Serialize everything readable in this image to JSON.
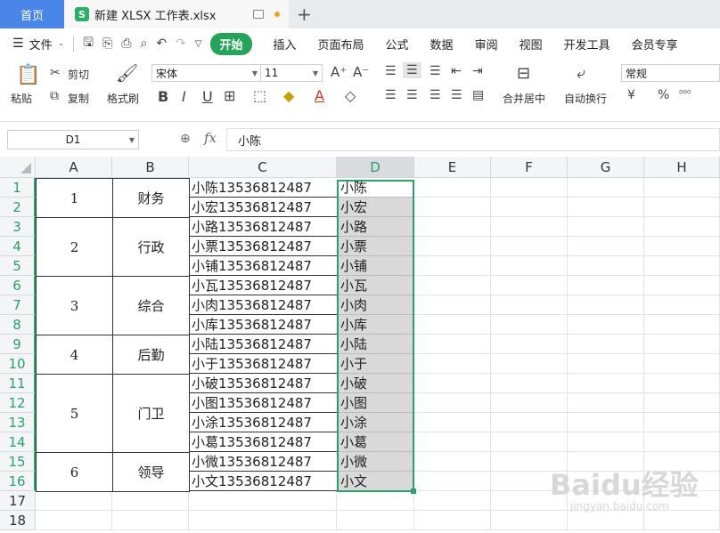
{
  "titlebar": {
    "home_tab": "首页",
    "file_tab": "新建 XLSX 工作表.xlsx",
    "file_logo": "S",
    "new_tab_glyph": "+"
  },
  "menubar": {
    "file_label": "文件",
    "start_label": "开始",
    "items": [
      "插入",
      "页面布局",
      "公式",
      "数据",
      "审阅",
      "视图",
      "开发工具",
      "会员专享"
    ]
  },
  "ribbon": {
    "paste": "粘贴",
    "cut": "剪切",
    "copy": "复制",
    "format_painter": "格式刷",
    "font_name": "宋体",
    "font_size": "11",
    "merge_center": "合并居中",
    "wrap_text": "自动换行",
    "number_format": "常规",
    "currency_symbol": "¥",
    "percent_symbol": "%"
  },
  "formula_bar": {
    "name_box": "D1",
    "fx": "fx",
    "value": "小陈"
  },
  "columns": [
    "A",
    "B",
    "C",
    "D",
    "E",
    "F",
    "G",
    "H"
  ],
  "selected_column": "D",
  "rows": [
    "1",
    "2",
    "3",
    "4",
    "5",
    "6",
    "7",
    "8",
    "9",
    "10",
    "11",
    "12",
    "13",
    "14",
    "15",
    "16",
    "17",
    "18"
  ],
  "merged_groups": [
    {
      "a": "1",
      "b": "财务",
      "rows": [
        1,
        2
      ]
    },
    {
      "a": "2",
      "b": "行政",
      "rows": [
        3,
        5
      ]
    },
    {
      "a": "3",
      "b": "综合",
      "rows": [
        6,
        8
      ]
    },
    {
      "a": "4",
      "b": "后勤",
      "rows": [
        9,
        10
      ]
    },
    {
      "a": "5",
      "b": "门卫",
      "rows": [
        11,
        14
      ]
    },
    {
      "a": "6",
      "b": "领导",
      "rows": [
        15,
        16
      ]
    }
  ],
  "column_c": [
    "小陈13536812487",
    "小宏13536812487",
    "小路13536812487",
    "小票13536812487",
    "小铺13536812487",
    "小瓦13536812487",
    "小肉13536812487",
    "小库13536812487",
    "小陆13536812487",
    "小于13536812487",
    "小破13536812487",
    "小图13536812487",
    "小涂13536812487",
    "小葛13536812487",
    "小微13536812487",
    "小文13536812487"
  ],
  "column_d": [
    "小陈",
    "小宏",
    "小路",
    "小票",
    "小铺",
    "小瓦",
    "小肉",
    "小库",
    "小陆",
    "小于",
    "小破",
    "小图",
    "小涂",
    "小葛",
    "小微",
    "小文"
  ],
  "watermark": {
    "main": "Baidu经验",
    "sub": "jingyan.baidu.com"
  },
  "colors": {
    "accent_green": "#2aa06a",
    "home_tab_blue": "#4a86e8",
    "selection_fill": "#d9d9d9"
  }
}
